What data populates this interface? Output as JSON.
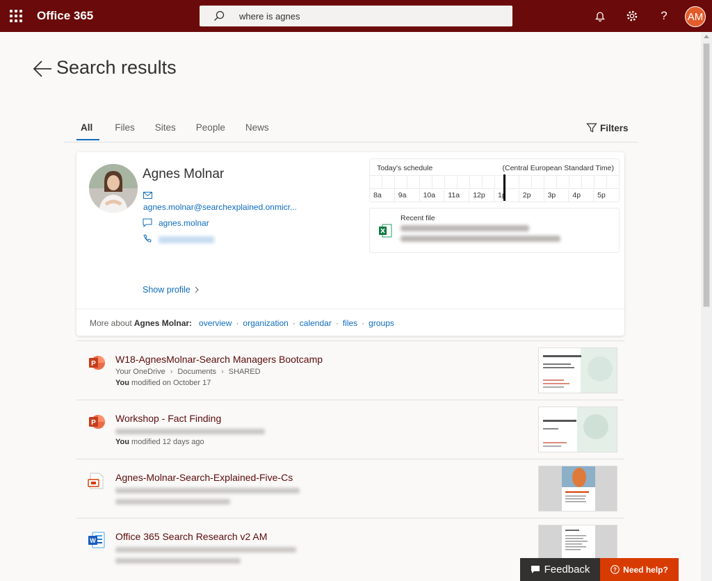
{
  "topbar": {
    "app_name": "Office 365",
    "search_value": "where is agnes",
    "user_initials": "AM"
  },
  "page": {
    "title": "Search results"
  },
  "tabs": [
    {
      "label": "All",
      "active": true
    },
    {
      "label": "Files",
      "active": false
    },
    {
      "label": "Sites",
      "active": false
    },
    {
      "label": "People",
      "active": false
    },
    {
      "label": "News",
      "active": false
    }
  ],
  "filters_label": "Filters",
  "person": {
    "name": "Agnes Molnar",
    "email": "agnes.molnar@searchexplained.onmicr...",
    "chat": "agnes.molnar",
    "show_profile": "Show profile",
    "schedule_title": "Today's schedule",
    "schedule_tz": "(Central European Standard Time)",
    "hours": [
      "8a",
      "9a",
      "10a",
      "11a",
      "12p",
      "1p",
      "2p",
      "3p",
      "4p",
      "5p"
    ],
    "recent_file_label": "Recent file",
    "more_about_prefix": "More about",
    "more_about_name": "Agnes Molnar:",
    "links": [
      "overview",
      "organization",
      "calendar",
      "files",
      "groups"
    ]
  },
  "results": [
    {
      "title": "W18-AgnesMolnar-Search Managers Bootcamp",
      "path": [
        "Your OneDrive",
        "Documents",
        "SHARED"
      ],
      "modified_by": "You",
      "modified": "modified on October 17",
      "type": "powerpoint"
    },
    {
      "title": "Workshop - Fact Finding",
      "path": [],
      "modified_by": "You",
      "modified": "modified 12 days ago",
      "type": "powerpoint"
    },
    {
      "title": "Agnes-Molnar-Search-Explained-Five-Cs",
      "path": [],
      "modified_by": "",
      "modified": "",
      "type": "video"
    },
    {
      "title": "Office 365 Search Research v2 AM",
      "path": [],
      "modified_by": "",
      "modified": "",
      "type": "word"
    }
  ],
  "footer": {
    "feedback": "Feedback",
    "need_help": "Need help?"
  },
  "colors": {
    "topbar": "#6b0a0a",
    "link": "#0f6cbd",
    "help": "#d83b01"
  }
}
